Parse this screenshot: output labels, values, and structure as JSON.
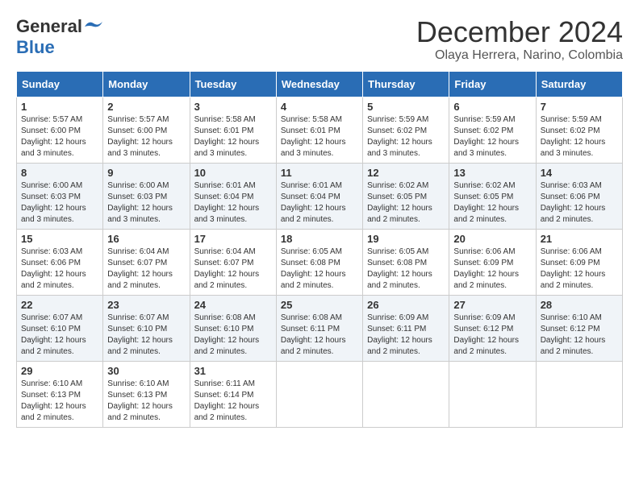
{
  "header": {
    "logo_general": "General",
    "logo_blue": "Blue",
    "month_title": "December 2024",
    "location": "Olaya Herrera, Narino, Colombia"
  },
  "calendar": {
    "weekdays": [
      "Sunday",
      "Monday",
      "Tuesday",
      "Wednesday",
      "Thursday",
      "Friday",
      "Saturday"
    ],
    "weeks": [
      [
        {
          "day": "1",
          "sunrise": "5:57 AM",
          "sunset": "6:00 PM",
          "daylight": "12 hours and 3 minutes."
        },
        {
          "day": "2",
          "sunrise": "5:57 AM",
          "sunset": "6:00 PM",
          "daylight": "12 hours and 3 minutes."
        },
        {
          "day": "3",
          "sunrise": "5:58 AM",
          "sunset": "6:01 PM",
          "daylight": "12 hours and 3 minutes."
        },
        {
          "day": "4",
          "sunrise": "5:58 AM",
          "sunset": "6:01 PM",
          "daylight": "12 hours and 3 minutes."
        },
        {
          "day": "5",
          "sunrise": "5:59 AM",
          "sunset": "6:02 PM",
          "daylight": "12 hours and 3 minutes."
        },
        {
          "day": "6",
          "sunrise": "5:59 AM",
          "sunset": "6:02 PM",
          "daylight": "12 hours and 3 minutes."
        },
        {
          "day": "7",
          "sunrise": "5:59 AM",
          "sunset": "6:02 PM",
          "daylight": "12 hours and 3 minutes."
        }
      ],
      [
        {
          "day": "8",
          "sunrise": "6:00 AM",
          "sunset": "6:03 PM",
          "daylight": "12 hours and 3 minutes."
        },
        {
          "day": "9",
          "sunrise": "6:00 AM",
          "sunset": "6:03 PM",
          "daylight": "12 hours and 3 minutes."
        },
        {
          "day": "10",
          "sunrise": "6:01 AM",
          "sunset": "6:04 PM",
          "daylight": "12 hours and 3 minutes."
        },
        {
          "day": "11",
          "sunrise": "6:01 AM",
          "sunset": "6:04 PM",
          "daylight": "12 hours and 2 minutes."
        },
        {
          "day": "12",
          "sunrise": "6:02 AM",
          "sunset": "6:05 PM",
          "daylight": "12 hours and 2 minutes."
        },
        {
          "day": "13",
          "sunrise": "6:02 AM",
          "sunset": "6:05 PM",
          "daylight": "12 hours and 2 minutes."
        },
        {
          "day": "14",
          "sunrise": "6:03 AM",
          "sunset": "6:06 PM",
          "daylight": "12 hours and 2 minutes."
        }
      ],
      [
        {
          "day": "15",
          "sunrise": "6:03 AM",
          "sunset": "6:06 PM",
          "daylight": "12 hours and 2 minutes."
        },
        {
          "day": "16",
          "sunrise": "6:04 AM",
          "sunset": "6:07 PM",
          "daylight": "12 hours and 2 minutes."
        },
        {
          "day": "17",
          "sunrise": "6:04 AM",
          "sunset": "6:07 PM",
          "daylight": "12 hours and 2 minutes."
        },
        {
          "day": "18",
          "sunrise": "6:05 AM",
          "sunset": "6:08 PM",
          "daylight": "12 hours and 2 minutes."
        },
        {
          "day": "19",
          "sunrise": "6:05 AM",
          "sunset": "6:08 PM",
          "daylight": "12 hours and 2 minutes."
        },
        {
          "day": "20",
          "sunrise": "6:06 AM",
          "sunset": "6:09 PM",
          "daylight": "12 hours and 2 minutes."
        },
        {
          "day": "21",
          "sunrise": "6:06 AM",
          "sunset": "6:09 PM",
          "daylight": "12 hours and 2 minutes."
        }
      ],
      [
        {
          "day": "22",
          "sunrise": "6:07 AM",
          "sunset": "6:10 PM",
          "daylight": "12 hours and 2 minutes."
        },
        {
          "day": "23",
          "sunrise": "6:07 AM",
          "sunset": "6:10 PM",
          "daylight": "12 hours and 2 minutes."
        },
        {
          "day": "24",
          "sunrise": "6:08 AM",
          "sunset": "6:10 PM",
          "daylight": "12 hours and 2 minutes."
        },
        {
          "day": "25",
          "sunrise": "6:08 AM",
          "sunset": "6:11 PM",
          "daylight": "12 hours and 2 minutes."
        },
        {
          "day": "26",
          "sunrise": "6:09 AM",
          "sunset": "6:11 PM",
          "daylight": "12 hours and 2 minutes."
        },
        {
          "day": "27",
          "sunrise": "6:09 AM",
          "sunset": "6:12 PM",
          "daylight": "12 hours and 2 minutes."
        },
        {
          "day": "28",
          "sunrise": "6:10 AM",
          "sunset": "6:12 PM",
          "daylight": "12 hours and 2 minutes."
        }
      ],
      [
        {
          "day": "29",
          "sunrise": "6:10 AM",
          "sunset": "6:13 PM",
          "daylight": "12 hours and 2 minutes."
        },
        {
          "day": "30",
          "sunrise": "6:10 AM",
          "sunset": "6:13 PM",
          "daylight": "12 hours and 2 minutes."
        },
        {
          "day": "31",
          "sunrise": "6:11 AM",
          "sunset": "6:14 PM",
          "daylight": "12 hours and 2 minutes."
        },
        null,
        null,
        null,
        null
      ]
    ]
  }
}
